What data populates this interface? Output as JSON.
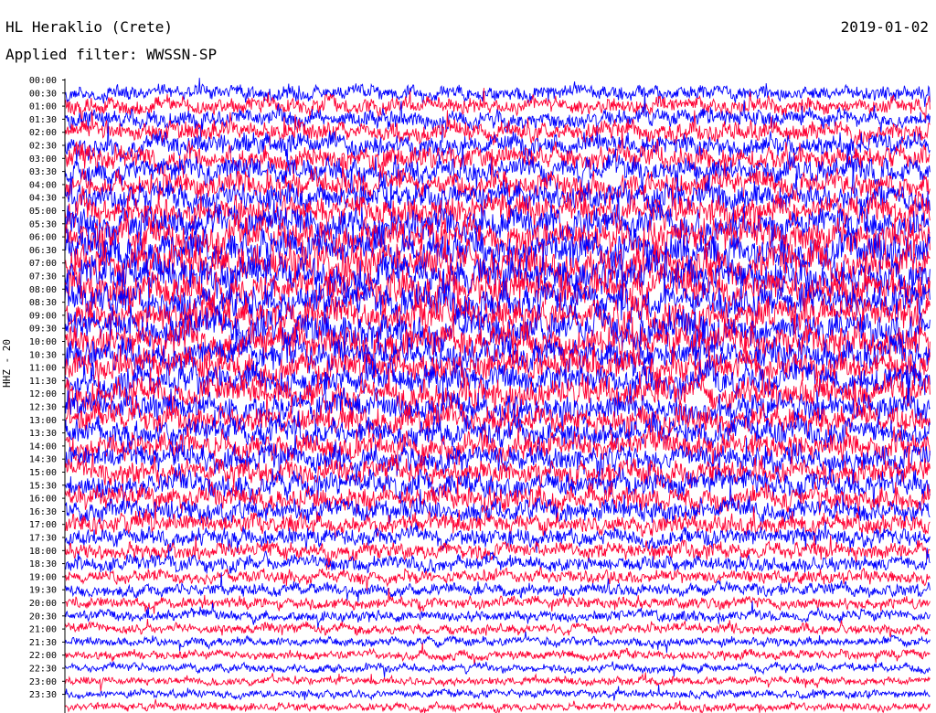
{
  "header": {
    "station": "HL Heraklio (Crete)",
    "date": "2019-01-02",
    "filter": "Applied filter: WWSSN-SP",
    "channel": "HHZ - 20"
  },
  "colors": {
    "background": "#ffffff",
    "trace_a": "#0000ff",
    "trace_b": "#ff0033",
    "axis": "#000000"
  },
  "chart_data": {
    "type": "line",
    "title": "HL Heraklio (Crete)",
    "subtitle": "Applied filter: WWSSN-SP",
    "ylabel": "HHZ - 20",
    "xlabel": "",
    "row_labels": [
      "00:00",
      "00:30",
      "01:00",
      "01:30",
      "02:00",
      "02:30",
      "03:00",
      "03:30",
      "04:00",
      "04:30",
      "05:00",
      "05:30",
      "06:00",
      "06:30",
      "07:00",
      "07:30",
      "08:00",
      "08:30",
      "09:00",
      "09:30",
      "10:00",
      "10:30",
      "11:00",
      "11:30",
      "12:00",
      "12:30",
      "13:00",
      "13:30",
      "14:00",
      "14:30",
      "15:00",
      "15:30",
      "16:00",
      "16:30",
      "17:00",
      "17:30",
      "18:00",
      "18:30",
      "19:00",
      "19:30",
      "20:00",
      "20:30",
      "21:00",
      "21:30",
      "22:00",
      "22:30",
      "23:00",
      "23:30"
    ],
    "row_colors_alternating": [
      "#0000ff",
      "#ff0033"
    ],
    "relative_amplitude_by_row": [
      0.9,
      1.0,
      1.1,
      1.2,
      1.3,
      1.4,
      1.5,
      1.6,
      1.7,
      1.8,
      1.9,
      2.0,
      2.1,
      2.2,
      2.2,
      2.1,
      2.0,
      2.0,
      2.1,
      2.0,
      1.9,
      1.8,
      1.8,
      1.8,
      1.7,
      1.7,
      1.6,
      1.6,
      1.6,
      1.5,
      1.5,
      1.4,
      1.3,
      1.2,
      1.1,
      1.0,
      0.9,
      0.8,
      0.75,
      0.7,
      0.65,
      0.6,
      0.55,
      0.55,
      0.5,
      0.5,
      0.5,
      0.5
    ],
    "grid": false,
    "legend": "none"
  }
}
